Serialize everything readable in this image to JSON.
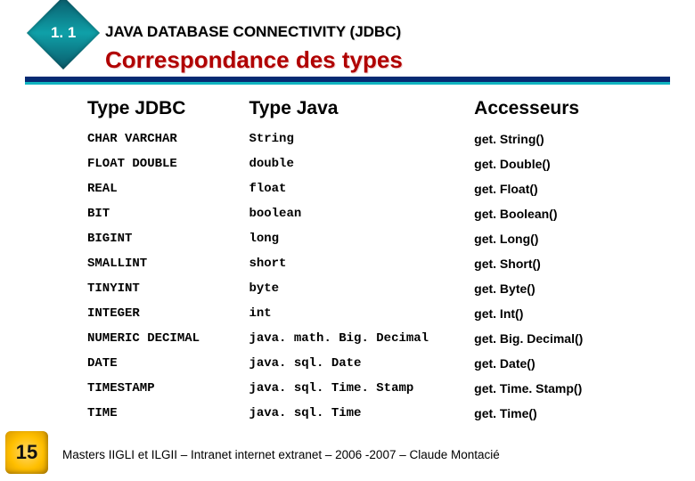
{
  "header": {
    "section_number": "1. 1",
    "chapter": "JAVA DATABASE CONNECTIVITY (JDBC)",
    "title": "Correspondance des types"
  },
  "table": {
    "headers": {
      "col1": "Type JDBC",
      "col2": "Type Java",
      "col3": "Accesseurs"
    },
    "rows": [
      {
        "jdbc": "CHAR VARCHAR",
        "java": "String",
        "acc": "get. String()"
      },
      {
        "jdbc": "FLOAT DOUBLE",
        "java": "double",
        "acc": "get. Double()"
      },
      {
        "jdbc": "REAL",
        "java": "float",
        "acc": "get. Float()"
      },
      {
        "jdbc": "BIT",
        "java": "boolean",
        "acc": "get. Boolean()"
      },
      {
        "jdbc": "BIGINT",
        "java": "long",
        "acc": "get. Long()"
      },
      {
        "jdbc": "SMALLINT",
        "java": "short",
        "acc": "get. Short()"
      },
      {
        "jdbc": "TINYINT",
        "java": "byte",
        "acc": "get. Byte()"
      },
      {
        "jdbc": "INTEGER",
        "java": "int",
        "acc": "get. Int()"
      },
      {
        "jdbc": "NUMERIC DECIMAL",
        "java": "java. math. Big. Decimal",
        "acc": "get. Big. Decimal()"
      },
      {
        "jdbc": "DATE",
        "java": "java. sql. Date",
        "acc": "get. Date()"
      },
      {
        "jdbc": "TIMESTAMP",
        "java": "java. sql. Time. Stamp",
        "acc": "get. Time. Stamp()"
      },
      {
        "jdbc": "TIME",
        "java": "java. sql. Time",
        "acc": "get. Time()"
      }
    ]
  },
  "page_number": "15",
  "footer": "Masters IIGLI et ILGII – Intranet internet extranet – 2006 -2007 – Claude Montacié"
}
